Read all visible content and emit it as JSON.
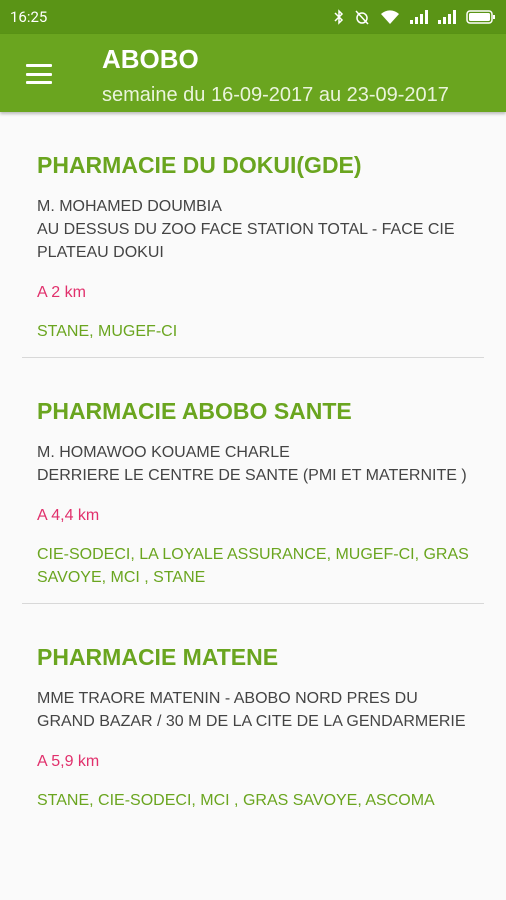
{
  "status_bar": {
    "time": "16:25",
    "icons": [
      "bluetooth-icon",
      "alarm-off-icon",
      "wifi-icon",
      "signal-icon",
      "signal-icon",
      "battery-icon"
    ]
  },
  "toolbar": {
    "title": "ABOBO",
    "subtitle": "semaine du 16-09-2017 au 23-09-2017",
    "menu_icon": "hamburger-menu-icon"
  },
  "colors": {
    "primary": "#6aa51f",
    "status_bar": "#5a9416",
    "distance": "#e1306c",
    "text": "#444444"
  },
  "pharmacies": [
    {
      "name": "PHARMACIE DU DOKUI(GDE)",
      "owner": "M. MOHAMED DOUMBIA",
      "address": "AU DESSUS DU ZOO FACE STATION TOTAL - FACE CIE PLATEAU DOKUI",
      "distance": "A 2 km",
      "insurances": "STANE, MUGEF-CI"
    },
    {
      "name": "PHARMACIE ABOBO SANTE",
      "owner": "M. HOMAWOO KOUAME CHARLE",
      "address": "DERRIERE LE CENTRE DE SANTE (PMI ET MATERNITE )",
      "distance": "A 4,4 km",
      "insurances": "CIE-SODECI, LA LOYALE ASSURANCE, MUGEF-CI, GRAS SAVOYE, MCI , STANE"
    },
    {
      "name": "PHARMACIE MATENE",
      "owner": "MME  TRAORE MATENIN - ABOBO NORD PRES DU GRAND BAZAR / 30 M DE LA CITE DE LA GENDARMERIE",
      "address": "",
      "distance": "A 5,9 km",
      "insurances": "STANE, CIE-SODECI, MCI , GRAS SAVOYE, ASCOMA"
    }
  ]
}
